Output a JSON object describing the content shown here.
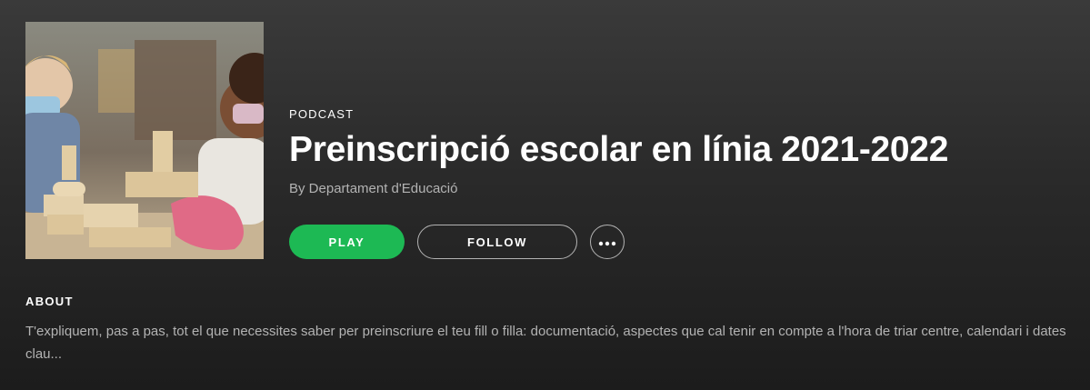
{
  "podcast": {
    "type_label": "PODCAST",
    "title": "Preinscripció escolar en línia 2021-2022",
    "author": "By Departament d'Educació",
    "cover_alt": "children-playing-with-wooden-blocks"
  },
  "actions": {
    "play_label": "PLAY",
    "follow_label": "FOLLOW",
    "more_icon": "more-options-icon"
  },
  "about": {
    "label": "ABOUT",
    "text": "T'expliquem, pas a pas, tot el que necessites saber per preinscriure el teu fill o filla: documentació, aspectes que cal tenir en compte a l'hora de triar centre, calendari i dates clau..."
  },
  "colors": {
    "accent": "#1db954",
    "text_secondary": "#b3b3b3",
    "background_top": "#3a3a3a",
    "background_bottom": "#1c1c1c"
  }
}
